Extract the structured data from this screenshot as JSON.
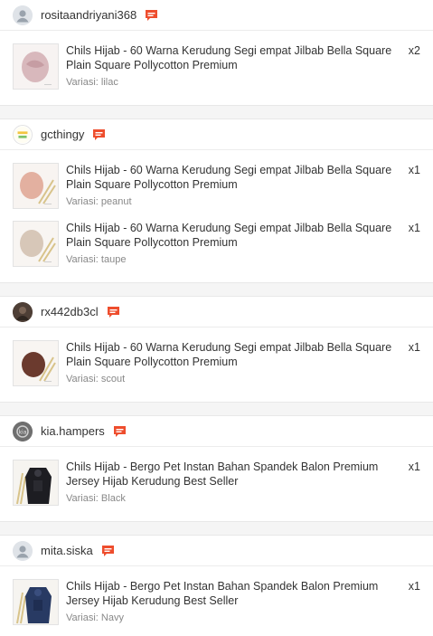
{
  "orders": [
    {
      "username": "rositaandriyani368",
      "avatar": "default-avatar",
      "items": [
        {
          "name": "Chils Hijab - 60 Warna Kerudung Segi empat Jilbab Bella Square Plain Square Pollycotton Premium",
          "variant": "Variasi: lilac",
          "qty": "x2",
          "color": "#d8b8bc"
        }
      ]
    },
    {
      "username": "gcthingy",
      "avatar": "shop-logo",
      "items": [
        {
          "name": "Chils Hijab - 60 Warna Kerudung Segi empat Jilbab Bella Square Plain Square Pollycotton Premium",
          "variant": "Variasi: peanut",
          "qty": "x1",
          "color": "#e3b0a0"
        },
        {
          "name": "Chils Hijab - 60 Warna Kerudung Segi empat Jilbab Bella Square Plain Square Pollycotton Premium",
          "variant": "Variasi: taupe",
          "qty": "x1",
          "color": "#d7c7b8"
        }
      ]
    },
    {
      "username": "rx442db3cl",
      "avatar": "photo-avatar",
      "items": [
        {
          "name": "Chils Hijab - 60 Warna Kerudung Segi empat Jilbab Bella Square Plain Square Pollycotton Premium",
          "variant": "Variasi: scout",
          "qty": "x1",
          "color": "#6b3a2e"
        }
      ]
    },
    {
      "username": "kia.hampers",
      "avatar": "photo-avatar",
      "items": [
        {
          "name": "Chils Hijab - Bergo Pet Instan Bahan Spandek Balon Premium Jersey Hijab Kerudung Best Seller",
          "variant": "Variasi: Black",
          "qty": "x1",
          "color": "#1d1d22"
        }
      ]
    },
    {
      "username": "mita.siska",
      "avatar": "default-avatar",
      "items": [
        {
          "name": "Chils Hijab - Bergo Pet Instan Bahan Spandek Balon Premium Jersey Hijab Kerudung Best Seller",
          "variant": "Variasi: Navy",
          "qty": "x1",
          "color": "#283a63"
        }
      ]
    }
  ],
  "colors": {
    "chat_icon": "#ee4d2d"
  }
}
